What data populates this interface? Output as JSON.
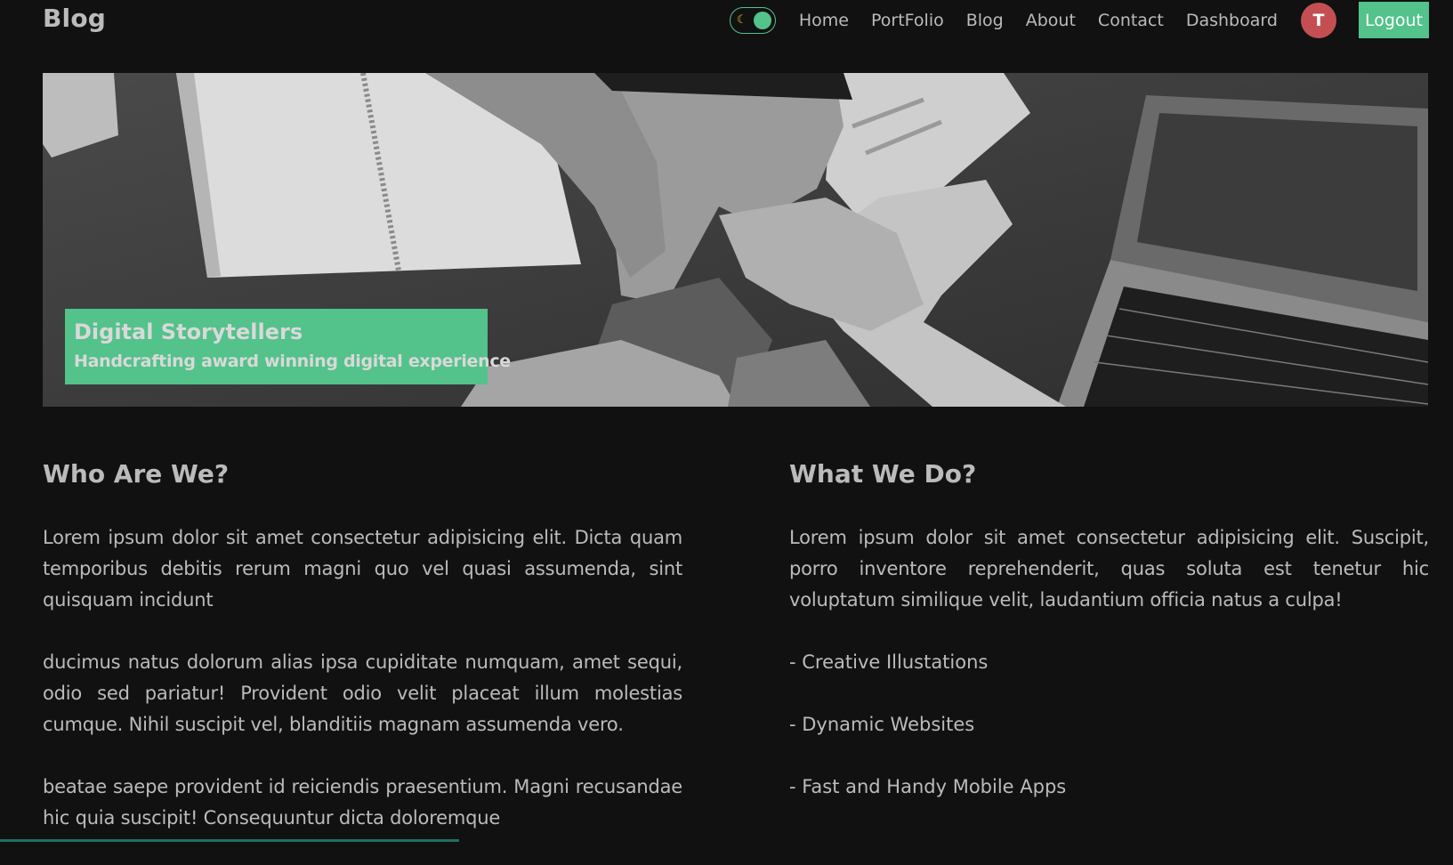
{
  "navbar": {
    "brand": "Blog",
    "theme_toggle_icon": "moon-icon",
    "links": [
      "Home",
      "PortFolio",
      "Blog",
      "About",
      "Contact",
      "Dashboard"
    ],
    "avatar_initial": "T",
    "logout_label": "Logout"
  },
  "hero": {
    "title": "Digital Storytellers",
    "subtitle": "Handcrafting award winning digital experience"
  },
  "about": {
    "heading": "Who Are We?",
    "paragraphs": [
      "Lorem ipsum dolor sit amet consectetur adipisicing elit. Dicta quam temporibus debitis rerum magni quo vel quasi assumenda, sint quisquam incidunt",
      "ducimus natus dolorum alias ipsa cupiditate numquam, amet sequi, odio sed pariatur! Provident odio velit placeat illum molestias cumque. Nihil suscipit vel, blanditiis magnam assumenda vero.",
      "beatae saepe provident id reiciendis praesentium. Magni recusandae hic quia suscipit! Consequuntur dicta doloremque"
    ]
  },
  "services": {
    "heading": "What We Do?",
    "intro": "Lorem ipsum dolor sit amet consectetur adipisicing elit. Suscipit, porro inventore reprehenderit, quas soluta est tenetur hic voluptatum similique velit, laudantium officia natus a culpa!",
    "items": [
      "- Creative Illustations",
      "- Dynamic Websites",
      "- Fast and Handy Mobile Apps"
    ]
  },
  "colors": {
    "background": "#111111",
    "accent": "#53c28b",
    "avatar": "#c44f52",
    "text": "#bbbbbb"
  }
}
